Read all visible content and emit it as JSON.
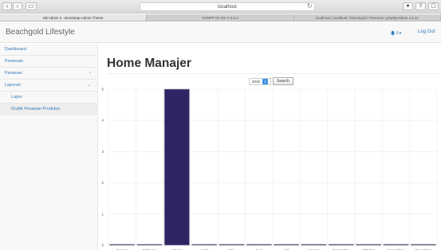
{
  "browser": {
    "url": "localhost",
    "tabs": [
      "SB Admin 2 - Bootstrap Admin Theme",
      "XAMPP for OS X 5.6.3",
      "localhost / localhost / beachgold / Pesanan | phpMyAdmin 4.2.11"
    ]
  },
  "header": {
    "brand": "Beachgold Lifestyle",
    "notif_count": "0",
    "logout": "Log Out"
  },
  "sidebar": {
    "items": [
      {
        "label": "Dashboard"
      },
      {
        "label": "Pemesan"
      },
      {
        "label": "Pesanan",
        "caret": "‹"
      },
      {
        "label": "Laporan",
        "caret": "⌄"
      },
      {
        "label": "Lapor"
      },
      {
        "label": "Grafik Pesanan Produksi"
      }
    ]
  },
  "main": {
    "title": "Home Manajer",
    "year": "2016",
    "search_label": "Search"
  },
  "chart_data": {
    "type": "bar",
    "categories": [
      "January",
      "Februari",
      "Maret",
      "April",
      "Mei",
      "Juni",
      "Juli",
      "Agustus",
      "September",
      "Oktober",
      "November",
      "Desember"
    ],
    "values": [
      0,
      0,
      5,
      0,
      0,
      0,
      0,
      0,
      0,
      0,
      0,
      0
    ],
    "ylim": [
      0,
      5
    ],
    "yticks": [
      0,
      1,
      2,
      3,
      4,
      5
    ],
    "grid": true,
    "bar_color": "#2e2565",
    "bar_stroke": "#a3a3a3"
  }
}
